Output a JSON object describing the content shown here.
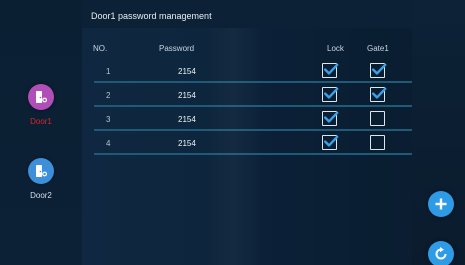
{
  "title": "Door1 password management",
  "sidebar": {
    "doors": [
      {
        "label": "Door1",
        "selected": true,
        "icon": "door-badge-icon",
        "icon_color": "#b14fb8",
        "label_color": "#d8252a"
      },
      {
        "label": "Door2",
        "selected": false,
        "icon": "door-badge-icon",
        "icon_color": "#3c8fd8",
        "label_color": "#d5dde6"
      }
    ]
  },
  "table": {
    "headers": {
      "no": "NO.",
      "password": "Password",
      "lock": "Lock",
      "gate": "Gate1"
    },
    "rows": [
      {
        "no": "1",
        "password": "2154",
        "lock": true,
        "gate": true
      },
      {
        "no": "2",
        "password": "2154",
        "lock": true,
        "gate": true
      },
      {
        "no": "3",
        "password": "2154",
        "lock": true,
        "gate": false
      },
      {
        "no": "4",
        "password": "2154",
        "lock": true,
        "gate": false
      }
    ]
  },
  "actions": {
    "add": {
      "icon": "plus-icon"
    },
    "refresh": {
      "icon": "refresh-icon"
    }
  },
  "colors": {
    "accent": "#2d9be6",
    "row_line": "#1f5a78",
    "check": "#3aa0e8"
  }
}
